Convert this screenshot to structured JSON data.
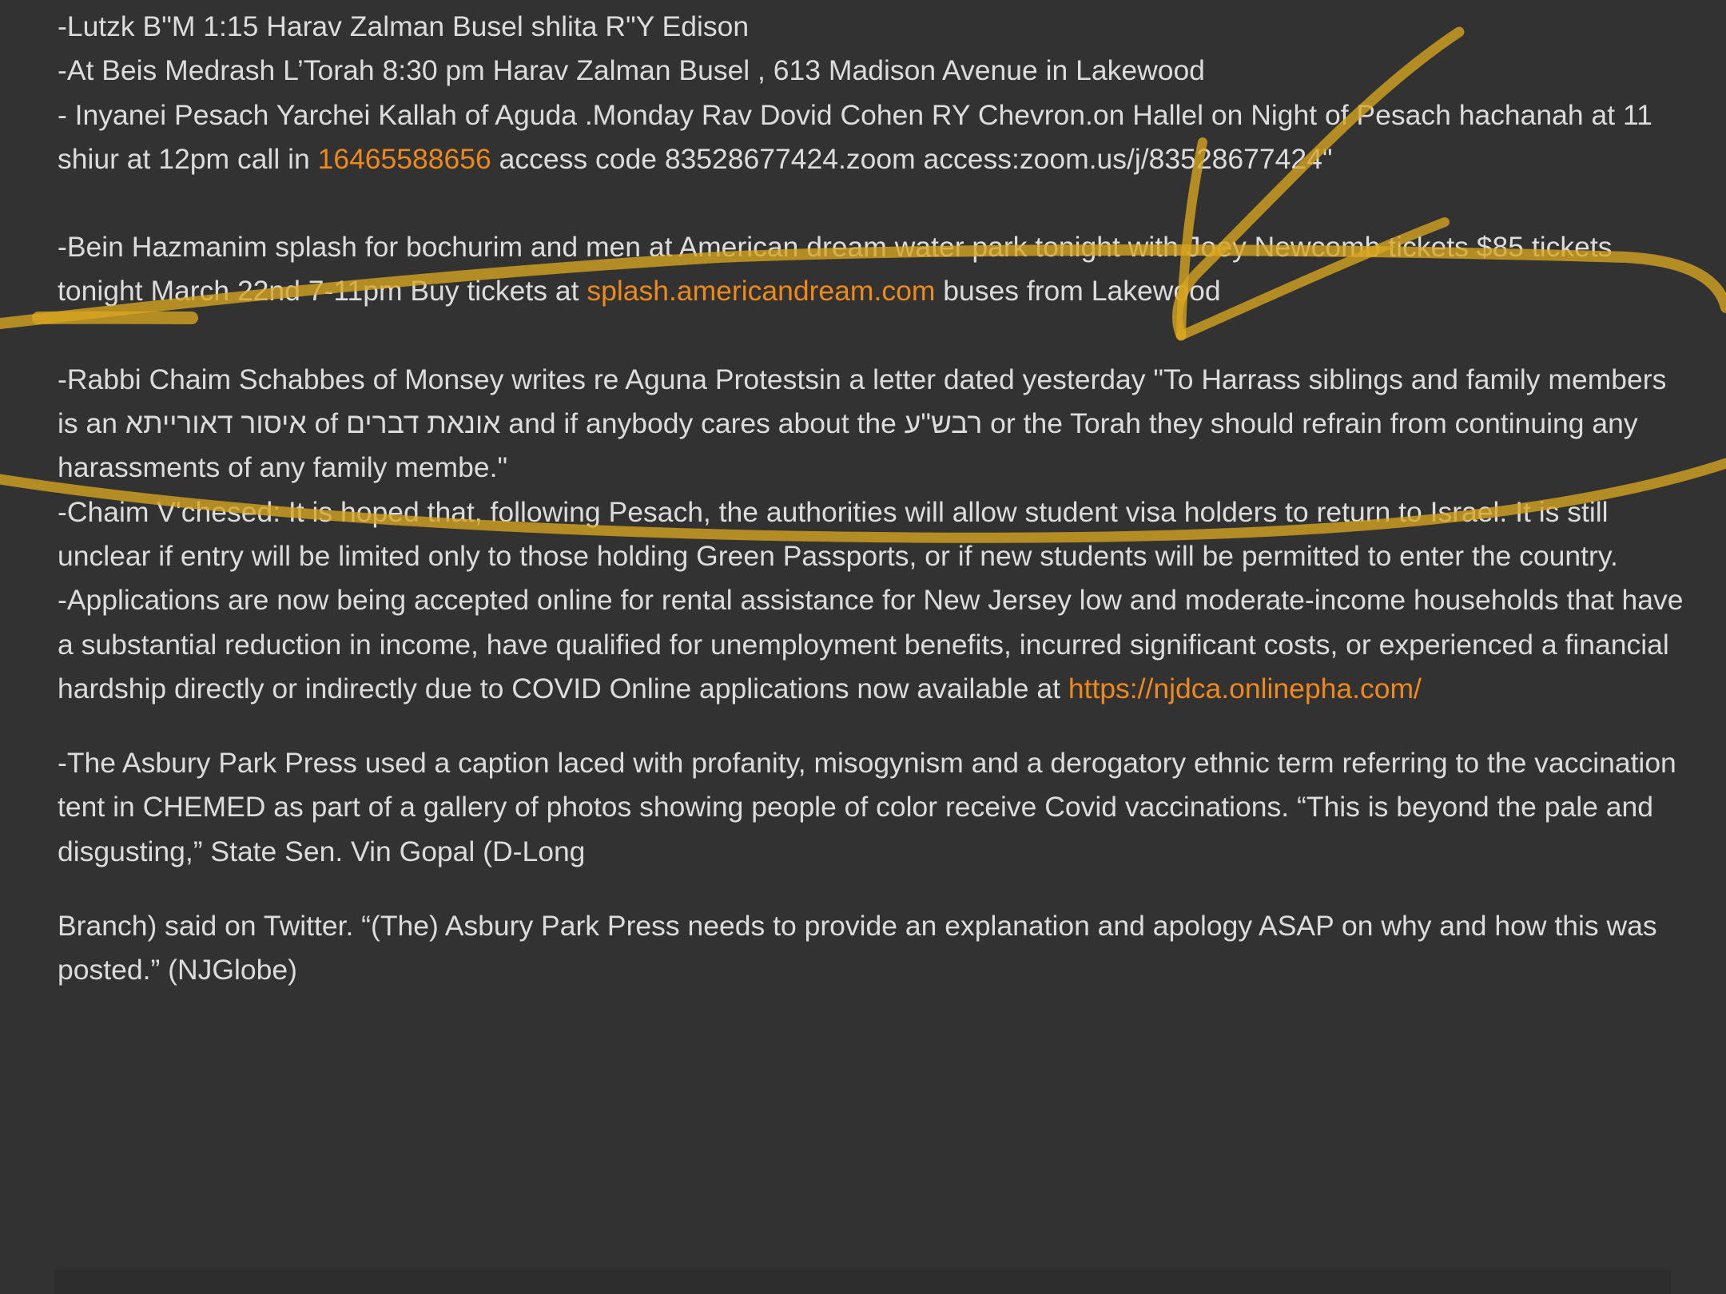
{
  "notes": {
    "line1": "-Lutzk B\"M 1:15 Harav Zalman Busel shlita R\"Y Edison",
    "line2": "-At Beis Medrash L’Torah 8:30 pm Harav Zalman Busel , 613 Madison Avenue in Lakewood",
    "pesach": {
      "intro": "- Inyanei Pesach Yarchei Kallah of Aguda .Monday Rav Dovid Cohen RY Chevron.on Hallel on Night of Pesach hachanah at 11 shiur at 12pm call in ",
      "phone": "16465588656",
      "outro": " access code 83528677424.zoom access:zoom.us/j/83528677424\""
    },
    "splash": {
      "intro": "-Bein Hazmanim splash for bochurim and men at American dream water park tonight with Joey Newcomb tickets $85 tickets tonight March 22nd 7-11pm Buy tickets at ",
      "link": "splash.americandream.com",
      "outro": " buses from Lakewood"
    },
    "aguna": "-Rabbi Chaim Schabbes of Monsey writes re Aguna Protestsin a letter dated yesterday \"To Harrass  siblings  and family members is an איסור דאורייתא of אונאת דברים and if anybody cares about the רבש\"ע or the Torah they should refrain from continuing any harassments of any family membe.\"",
    "chaim": "-Chaim V'chesed:  It is hoped that, following Pesach, the authorities will allow student visa holders to return to Israel. It is still unclear if entry will be limited only to those holding Green Passports, or if new students will be permitted to enter the country.",
    "rental": {
      "intro": "-Applications are now being accepted online for rental assistance for New Jersey low and moderate-income households that have a substantial reduction in income, have qualified for unemployment benefits, incurred significant costs, or experienced a financial hardship directly or indirectly due to COVID Online applications now available at ",
      "link": "https://njdca.onlinepha.com/"
    },
    "asbury1": "-The Asbury Park Press used a caption laced with profanity, misogynism and a derogatory ethnic term referring to the vaccination tent in CHEMED  as part of a gallery of photos showing people of color receive Covid vaccinations. “This is beyond the pale and disgusting,” State Sen. Vin Gopal (D-Long",
    "asbury2": "Branch) said on Twitter.   “(The) Asbury Park Press needs to provide an explanation and apology ASAP on why and how this was posted.” (NJGlobe)"
  },
  "colors": {
    "background": "#323232",
    "text": "#dcdcdc",
    "link": "#ee8a1c",
    "highlighter": "#d9a520"
  }
}
